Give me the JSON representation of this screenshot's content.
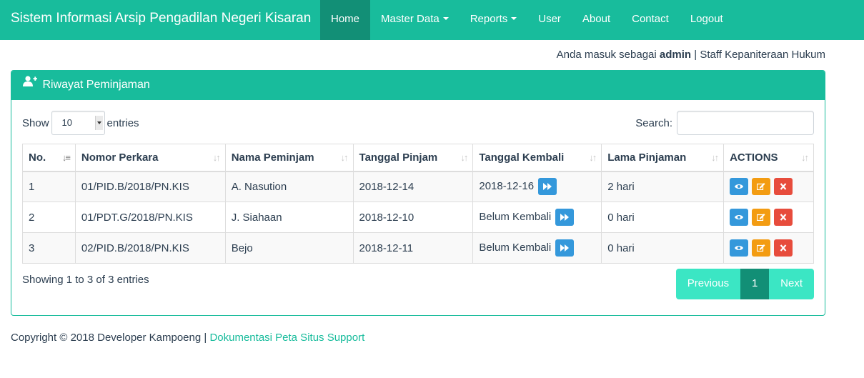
{
  "brand": "Sistem Informasi Arsip Pengadilan Negeri Kisaran",
  "nav": {
    "home": "Home",
    "master_data": "Master Data",
    "reports": "Reports",
    "user": "User",
    "about": "About",
    "contact": "Contact",
    "logout": "Logout"
  },
  "login": {
    "prefix": "Anda masuk sebagai",
    "username": "admin",
    "separator": "|",
    "role": "Staff Kepaniteraan Hukum"
  },
  "panel": {
    "title": "Riwayat Peminjaman",
    "icon": "user-plus-icon"
  },
  "controls": {
    "show_label": "Show",
    "entries_value": "10",
    "entries_label": "entries",
    "search_label": "Search:"
  },
  "table": {
    "headers": [
      "No.",
      "Nomor Perkara",
      "Nama Peminjam",
      "Tanggal Pinjam",
      "Tanggal Kembali",
      "Lama Pinjaman",
      "ACTIONS"
    ],
    "rows": [
      {
        "no": "1",
        "nomor": "01/PID.B/2018/PN.KIS",
        "nama": "A. Nasution",
        "pinjam": "2018-12-14",
        "kembali": "2018-12-16",
        "lama": "2 hari"
      },
      {
        "no": "2",
        "nomor": "01/PDT.G/2018/PN.KIS",
        "nama": "J. Siahaan",
        "pinjam": "2018-12-10",
        "kembali": "Belum Kembali",
        "lama": "0 hari"
      },
      {
        "no": "3",
        "nomor": "02/PID.B/2018/PN.KIS",
        "nama": "Bejo",
        "pinjam": "2018-12-11",
        "kembali": "Belum Kembali",
        "lama": "0 hari"
      }
    ]
  },
  "info": "Showing 1 to 3 of 3 entries",
  "pagination": {
    "previous": "Previous",
    "current": "1",
    "next": "Next"
  },
  "footer": {
    "copyright": "Copyright © 2018 Developer Kampoeng |",
    "links": "Dokumentasi Peta Situs Support"
  },
  "colors": {
    "primary": "#18bc9c",
    "primary_dark": "#128f76",
    "info": "#3498db",
    "warning": "#f39c12",
    "danger": "#e74c3c"
  }
}
